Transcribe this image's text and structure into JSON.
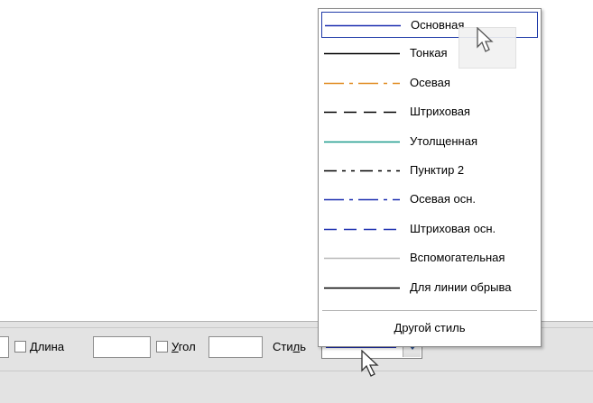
{
  "toolbar": {
    "length_label": "Длина",
    "length_label_u": "Д",
    "length_label_rest": "лина",
    "angle_label_u": "У",
    "angle_label_rest": "гол",
    "style_label_pre": "Сти",
    "style_label_u": "л",
    "style_label_post": "ь",
    "length_value": "",
    "angle_value": ""
  },
  "style_dropdown": {
    "selected": "Основная",
    "items": [
      {
        "label": "Основная",
        "color": "#1c2fb0",
        "pattern": "solid"
      },
      {
        "label": "Тонкая",
        "color": "#000000",
        "pattern": "solid"
      },
      {
        "label": "Осевая",
        "color": "#e08a1e",
        "pattern": "dashdot"
      },
      {
        "label": "Штриховая",
        "color": "#000000",
        "pattern": "dashed"
      },
      {
        "label": "Утолщенная",
        "color": "#1a9a8c",
        "pattern": "solid"
      },
      {
        "label": "Пунктир 2",
        "color": "#000000",
        "pattern": "dashdotdot"
      },
      {
        "label": "Осевая осн.",
        "color": "#1c2fb0",
        "pattern": "dashdot"
      },
      {
        "label": "Штриховая осн.",
        "color": "#1c2fb0",
        "pattern": "dashed"
      },
      {
        "label": "Вспомогательная",
        "color": "#b8b8b8",
        "pattern": "solid"
      },
      {
        "label": "Для линии обрыва",
        "color": "#000000",
        "pattern": "solid"
      }
    ],
    "other_label": "Другой стиль"
  }
}
